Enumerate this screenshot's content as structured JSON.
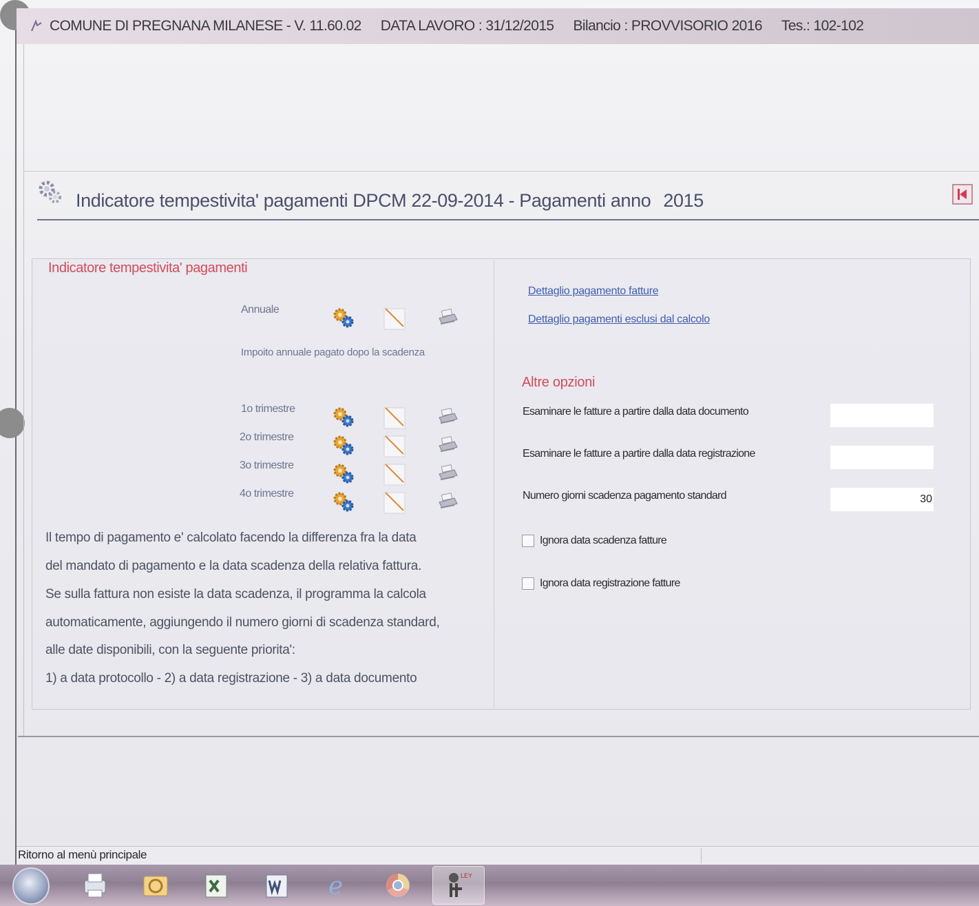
{
  "window": {
    "app_name": "COMUNE DI PREGNANA MILANESE - V. 11.60.02",
    "data_lavoro": "DATA LAVORO : 31/12/2015",
    "bilancio": "Bilancio : PROVVISORIO 2016",
    "tesoreria": "Tes.: 102-102"
  },
  "panel": {
    "title": "Indicatore tempestivita' pagamenti DPCM 22-09-2014 - Pagamenti anno",
    "year": "2015",
    "icons": {
      "header": "gear-icon",
      "exit": "exit-icon"
    }
  },
  "left": {
    "heading": "Indicatore tempestivita' pagamenti",
    "annual_label": "Annuale",
    "annual_note": "Impoito annuale pagato dopo la scadenza",
    "quarters": [
      "1o trimestre",
      "2o trimestre",
      "3o trimestre",
      "4o trimestre"
    ],
    "description": [
      "Il tempo di pagamento e' calcolato facendo la differenza fra la data",
      "del mandato di pagamento e la data scadenza della relativa fattura.",
      "Se sulla fattura non esiste la data scadenza, il programma la calcola",
      "automaticamente, aggiungendo il numero giorni di scadenza standard,",
      "alle date disponibili, con la seguente priorita':",
      "1) a data protocollo - 2) a data registrazione - 3) a data documento"
    ],
    "row_icons": [
      "calculate-icon",
      "pencil-icon",
      "print-icon"
    ]
  },
  "right": {
    "links": [
      "Dettaglio pagamento fatture",
      "Dettaglio pagamenti esclusi dal calcolo"
    ],
    "heading": "Altre opzioni",
    "options": [
      {
        "label": "Esaminare le fatture a partire dalla data documento",
        "value": ""
      },
      {
        "label": "Esaminare le fatture a partire dalla data registrazione",
        "value": ""
      },
      {
        "label": "Numero giorni scadenza pagamento standard",
        "value": "30"
      }
    ],
    "checkboxes": [
      {
        "label": "Ignora data scadenza fatture",
        "checked": false
      },
      {
        "label": "Ignora data registrazione fatture",
        "checked": false
      }
    ]
  },
  "status_bar": {
    "text": "Ritorno al menù principale"
  },
  "taskbar": {
    "items": [
      "start-orb-icon",
      "printer-icon",
      "outlook-icon",
      "excel-icon",
      "word-icon",
      "internet-explorer-icon",
      "chrome-icon",
      "app-launcher-icon"
    ]
  }
}
